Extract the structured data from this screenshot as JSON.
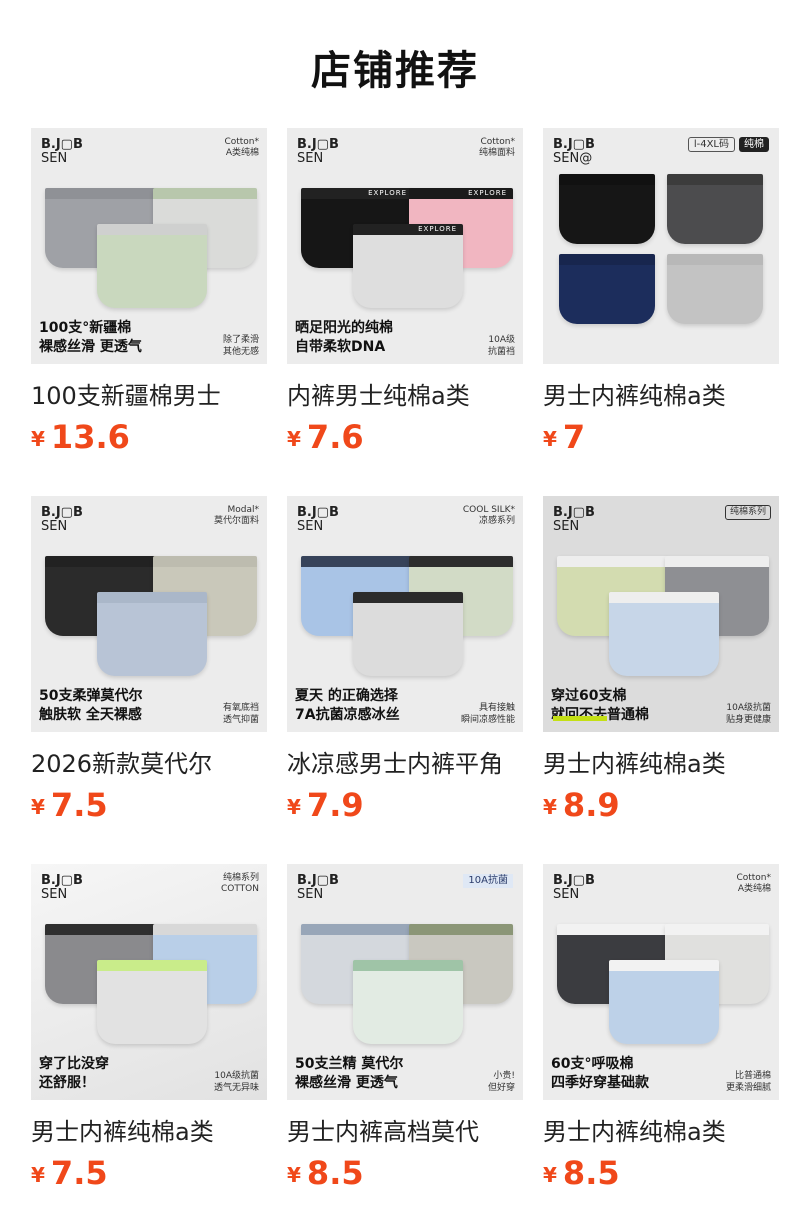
{
  "section_title": "店铺推荐",
  "currency_symbol": "¥",
  "products": [
    {
      "brand_line1": "B.J▢B",
      "brand_line2": "SEN",
      "corner_line1": "Cotton*",
      "corner_line2": "A类纯棉",
      "main_line1": "100支°新疆棉",
      "main_line2": "裸感丝滑 更透气",
      "side_line1": "除了柔滑",
      "side_line2": "其他无感",
      "name": "100支新疆棉男士",
      "price": "13.6",
      "band_label": "",
      "colors": [
        "#9fa1a6",
        "#dadbd9",
        "#c9d8be"
      ]
    },
    {
      "brand_line1": "B.J▢B",
      "brand_line2": "SEN",
      "corner_line1": "Cotton*",
      "corner_line2": "纯棉面料",
      "main_line1": "晒足阳光的纯棉",
      "main_line2": "自带柔软DNA",
      "side_line1": "10A级",
      "side_line2": "抗菌裆",
      "name": "内裤男士纯棉a类",
      "price": "7.6",
      "band_label": "EXPLORE",
      "colors": [
        "#161616",
        "#f1b6c1",
        "#dedede"
      ]
    },
    {
      "brand_line1": "B.J▢B",
      "brand_line2": "SEN@",
      "size_tag": "l-4XL码",
      "tag_dark": "纯棉",
      "name": "男士内裤纯棉a类",
      "price": "7",
      "band_label": "",
      "colors": [
        "#161616",
        "#4c4c4e",
        "#1c2d5c",
        "#c3c3c3"
      ]
    },
    {
      "brand_line1": "B.J▢B",
      "brand_line2": "SEN",
      "corner_line1": "Modal*",
      "corner_line2": "莫代尔面料",
      "main_line1": "50支柔弹莫代尔",
      "main_line2": "触肤软 全天裸感",
      "side_line1": "有氧底裆",
      "side_line2": "透气抑菌",
      "name": "2026新款莫代尔",
      "price": "7.5",
      "band_label": "",
      "colors": [
        "#2b2b2b",
        "#c9c8ba",
        "#b8c4d6"
      ]
    },
    {
      "brand_line1": "B.J▢B",
      "brand_line2": "SEN",
      "corner_line1": "COOL SILK*",
      "corner_line2": "凉感系列",
      "main_line1": "夏天 的正确选择",
      "main_line2": "7A抗菌凉感冰丝",
      "side_line1": "具有接触",
      "side_line2": "瞬间凉感性能",
      "name": "冰凉感男士内裤平角",
      "price": "7.9",
      "band_label": "",
      "colors": [
        "#a9c4e6",
        "#d2dbc6",
        "#dcdcdc"
      ]
    },
    {
      "brand_line1": "B.J▢B",
      "brand_line2": "SEN",
      "tag_outline": "纯棉系列",
      "main_line1": "穿过60支棉",
      "main_line2": "就回不去普通棉",
      "side_line1": "10A级抗菌",
      "side_line2": "贴身更健康",
      "name": "男士内裤纯棉a类",
      "price": "8.9",
      "band_label": "",
      "colors": [
        "#d3dcb0",
        "#8e8f93",
        "#c7d6e8"
      ]
    },
    {
      "brand_line1": "B.J▢B",
      "brand_line2": "SEN",
      "corner_line1": "纯棉系列",
      "corner_line2": "COTTON",
      "main_line1": "穿了比没穿",
      "main_line2": "还舒服！",
      "side_line1": "10A级抗菌",
      "side_line2": "透气无异味",
      "name": "男士内裤纯棉a类",
      "price": "7.5",
      "band_label": "",
      "colors": [
        "#8a8a8d",
        "#b9cfe8",
        "#e2e2e2"
      ]
    },
    {
      "brand_line1": "B.J▢B",
      "brand_line2": "SEN",
      "tag_blue": "10A抗菌",
      "main_line1": "50支兰精 莫代尔",
      "main_line2": "裸感丝滑 更透气",
      "side_line1": "小贵!",
      "side_line2": "但好穿",
      "name": "男士内裤高档莫代",
      "price": "8.5",
      "band_label": "",
      "colors": [
        "#d4d8dd",
        "#c9c8c0",
        "#e2ebe3"
      ]
    },
    {
      "brand_line1": "B.J▢B",
      "brand_line2": "SEN",
      "corner_line1": "Cotton*",
      "corner_line2": "A类纯棉",
      "main_line1": "60支°呼吸棉",
      "main_line2": "四季好穿基础款",
      "side_line1": "比普通棉",
      "side_line2": "更柔滑细腻",
      "name": "男士内裤纯棉a类",
      "price": "8.5",
      "band_label": "",
      "colors": [
        "#3b3c40",
        "#e0e0de",
        "#bdd1e8"
      ]
    }
  ]
}
